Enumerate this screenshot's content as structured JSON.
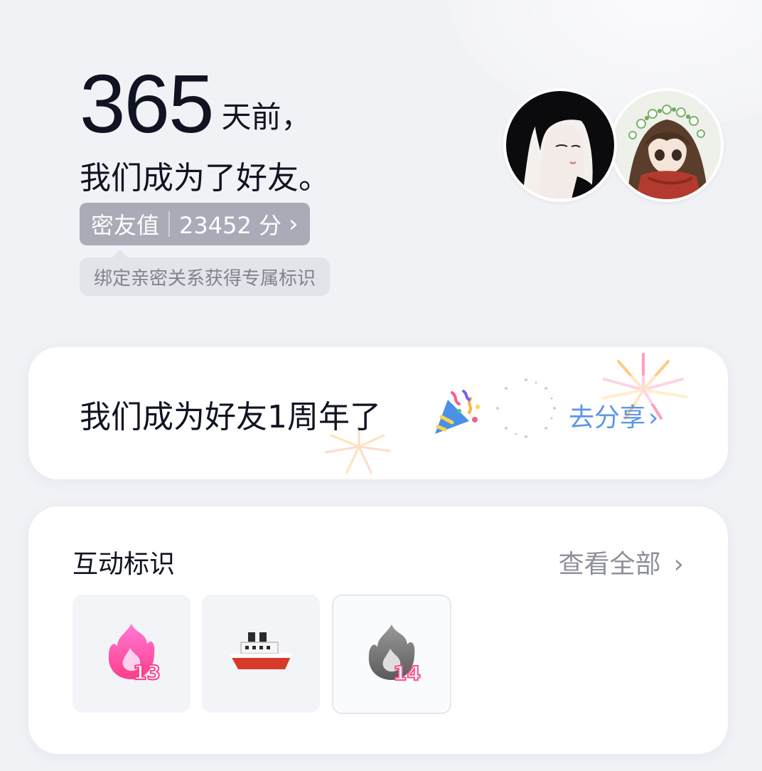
{
  "header": {
    "days_number": "365",
    "days_suffix": "天前，",
    "friend_line": "我们成为了好友。"
  },
  "intimacy": {
    "label": "密友值",
    "value": "23452 分",
    "chevron": "›"
  },
  "tip": {
    "text": "绑定亲密关系获得专属标识"
  },
  "avatars": [
    {
      "name": "avatar-dark-hair-girl"
    },
    {
      "name": "avatar-flower-crown-girl"
    }
  ],
  "anniversary_card": {
    "text": "我们成为好友1周年了",
    "icon": "party-popper-icon",
    "share_label": "去分享",
    "share_chevron": "›",
    "accent_color": "#5d96e6"
  },
  "badges_card": {
    "title": "互动标识",
    "view_all_label": "查看全部",
    "view_all_chevron": "›",
    "items": [
      {
        "icon": "pink-flame-icon",
        "number": "13"
      },
      {
        "icon": "ship-icon",
        "number": ""
      },
      {
        "icon": "gray-flame-icon",
        "number": "14"
      }
    ]
  }
}
